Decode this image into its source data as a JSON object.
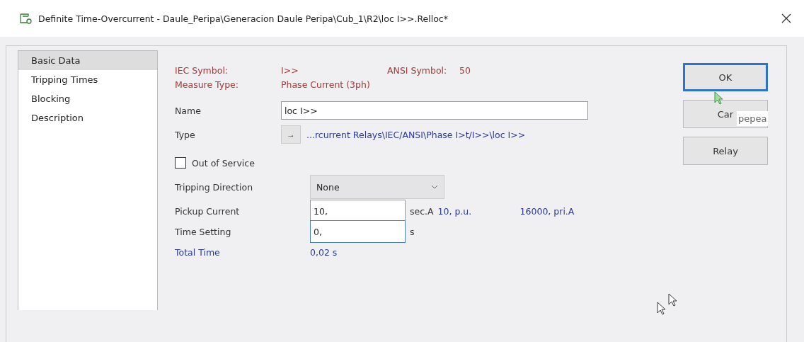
{
  "window": {
    "title": "Definite Time-Overcurrent - Daule_Peripa\\Generacion Daule Peripa\\Cub_1\\R2\\loc I>>.Relloc*"
  },
  "sidebar": {
    "items": [
      {
        "label": "Basic Data",
        "selected": true
      },
      {
        "label": "Tripping Times",
        "selected": false
      },
      {
        "label": "Blocking",
        "selected": false
      },
      {
        "label": "Description",
        "selected": false
      }
    ]
  },
  "info": {
    "iec_label": "IEC Symbol:",
    "iec_value": "I>>",
    "ansi_label": "ANSI Symbol:",
    "ansi_value": "50",
    "measure_label": "Measure Type:",
    "measure_value": "Phase Current (3ph)"
  },
  "name_field": {
    "label": "Name",
    "value": "loc I>>"
  },
  "type_field": {
    "label": "Type",
    "arrow": "→",
    "path": "...rcurrent Relays\\IEC/ANSI\\Phase I>t/I>>\\loc I>>"
  },
  "out_of_service": {
    "label": "Out of Service",
    "checked": false
  },
  "tripping_direction": {
    "label": "Tripping Direction",
    "value": "None"
  },
  "pickup_current": {
    "label": "Pickup Current",
    "value": "10,",
    "unit": "sec.A",
    "pu": "10, p.u.",
    "primary": "16000, pri.A"
  },
  "time_setting": {
    "label": "Time Setting",
    "value": "0,",
    "unit": "s",
    "focused": true
  },
  "total_time": {
    "label": "Total Time",
    "value": "0,02 s"
  },
  "buttons": [
    {
      "label": "OK",
      "default": true
    },
    {
      "label": "Car",
      "default": false
    },
    {
      "label": "Relay",
      "default": false
    }
  ],
  "tooltip": {
    "text": "pepea"
  }
}
